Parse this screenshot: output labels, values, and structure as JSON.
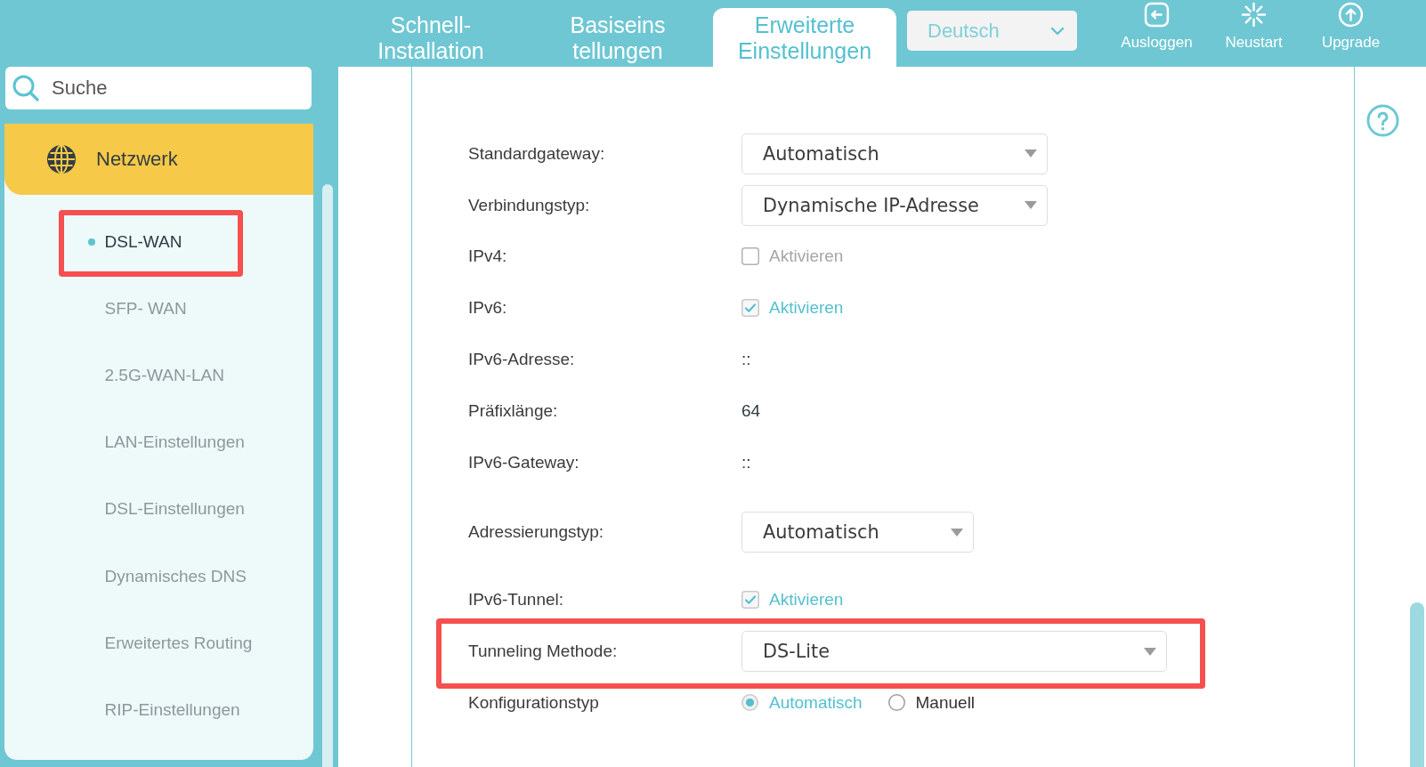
{
  "header": {
    "tabs": [
      {
        "label": "Schnell-\nInstallation",
        "selected": false
      },
      {
        "label": "Basiseins\ntellungen",
        "selected": false
      },
      {
        "label": "Erweiterte\nEinstellungen",
        "selected": true
      }
    ],
    "language": {
      "value": "Deutsch"
    },
    "actions": [
      {
        "kind": "logout",
        "label": "Ausloggen"
      },
      {
        "kind": "restart",
        "label": "Neustart"
      },
      {
        "kind": "upgrade",
        "label": "Upgrade"
      }
    ]
  },
  "sidebar": {
    "search": {
      "placeholder": "Suche"
    },
    "section": {
      "label": "Netzwerk"
    },
    "items": [
      {
        "label": "DSL-WAN",
        "selected": true,
        "highlighted": true
      },
      {
        "label": "SFP- WAN",
        "selected": false,
        "highlighted": false
      },
      {
        "label": "2.5G-WAN-LAN",
        "selected": false,
        "highlighted": false
      },
      {
        "label": "LAN-Einstellungen",
        "selected": false,
        "highlighted": false
      },
      {
        "label": "DSL-Einstellungen",
        "selected": false,
        "highlighted": false
      },
      {
        "label": "Dynamisches DNS",
        "selected": false,
        "highlighted": false
      },
      {
        "label": "Erweitertes Routing",
        "selected": false,
        "highlighted": false
      },
      {
        "label": "RIP-Einstellungen",
        "selected": false,
        "highlighted": false
      }
    ]
  },
  "form": {
    "rows": [
      {
        "kind": "select",
        "label": "Standardgateway:",
        "value": "Automatisch",
        "highlighted": false
      },
      {
        "kind": "select",
        "label": "Verbindungstyp:",
        "value": "Dynamische IP-Adresse",
        "highlighted": false
      },
      {
        "kind": "checkbox",
        "label": "IPv4:",
        "option": "Aktivieren",
        "checked": false,
        "highlighted": false
      },
      {
        "kind": "checkbox",
        "label": "IPv6:",
        "option": "Aktivieren",
        "checked": true,
        "highlighted": false
      },
      {
        "kind": "text",
        "label": "IPv6-Adresse:",
        "value": "::",
        "highlighted": false
      },
      {
        "kind": "text",
        "label": "Präfixlänge:",
        "value": "64",
        "highlighted": false
      },
      {
        "kind": "text",
        "label": "IPv6-Gateway:",
        "value": "::",
        "highlighted": false
      },
      {
        "kind": "select",
        "label": "Adressierungstyp:",
        "value": "Automatisch",
        "highlighted": false
      },
      {
        "kind": "checkbox",
        "label": "IPv6-Tunnel:",
        "option": "Aktivieren",
        "checked": true,
        "highlighted": false
      },
      {
        "kind": "select",
        "label": "Tunneling Methode:",
        "value": "DS-Lite",
        "highlighted": true
      },
      {
        "kind": "radio",
        "label": "Konfigurationstyp",
        "options": [
          {
            "label": "Automatisch",
            "selected": true
          },
          {
            "label": "Manuell",
            "selected": false
          }
        ],
        "highlighted": false
      }
    ]
  }
}
